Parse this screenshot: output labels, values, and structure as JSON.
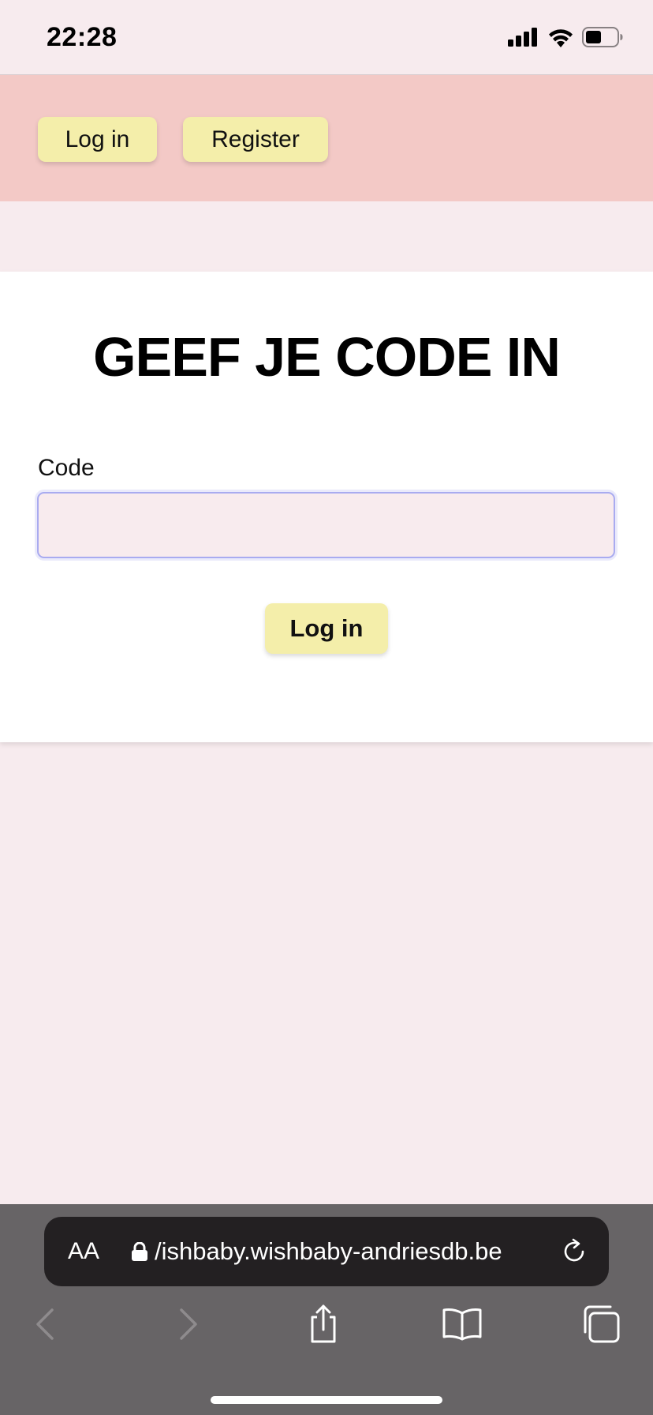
{
  "status_bar": {
    "time": "22:28",
    "icons": [
      "cellular-signal-icon",
      "wifi-icon",
      "battery-icon"
    ]
  },
  "nav": {
    "login_label": "Log in",
    "register_label": "Register"
  },
  "card": {
    "title": "GEEF JE CODE IN",
    "code_label": "Code",
    "code_value": "",
    "code_placeholder": "",
    "submit_label": "Log in"
  },
  "browser": {
    "text_size_label": "AA",
    "url": "/ishbaby.wishbaby-andriesdb.be",
    "toolbar": [
      "back-icon",
      "forward-icon",
      "share-icon",
      "bookmarks-icon",
      "tabs-icon"
    ]
  },
  "colors": {
    "page_background": "#f7ebee",
    "header_background": "#f3c9c6",
    "button_background": "#f4eeaa",
    "input_border": "#a9abf0",
    "browser_chrome": "#676466"
  }
}
